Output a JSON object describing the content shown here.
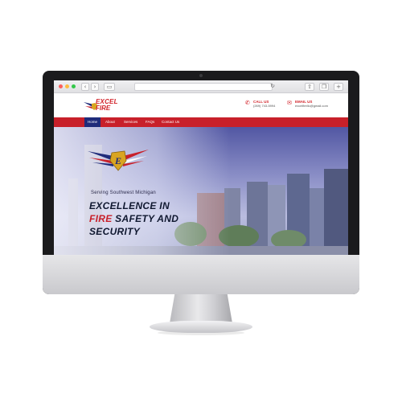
{
  "site": {
    "logo_line1": "EXCEL",
    "logo_line2": "FIRE",
    "call": {
      "label": "CALL US",
      "value": "(269) 743-5994"
    },
    "email": {
      "label": "EMAIL US",
      "value": "excelfirellc@gmail.com"
    },
    "nav": [
      {
        "label": "Home",
        "active": true
      },
      {
        "label": "About",
        "active": false
      },
      {
        "label": "Services",
        "active": false
      },
      {
        "label": "FAQs",
        "active": false
      },
      {
        "label": "Contact Us",
        "active": false
      }
    ],
    "hero": {
      "eyebrow": "Serving Southwest Michigan",
      "line1": "EXCELLENCE IN",
      "line2_red": "FIRE",
      "line2_rest": " SAFETY AND",
      "line3": "SECURITY"
    }
  },
  "colors": {
    "brand_red": "#c8202a",
    "active_nav": "#1f2b7a",
    "monitor_bezel": "#1b1b1d"
  },
  "icons": {
    "phone": "phone-icon",
    "email": "envelope-icon",
    "emblem": "shield-wings-emblem"
  }
}
